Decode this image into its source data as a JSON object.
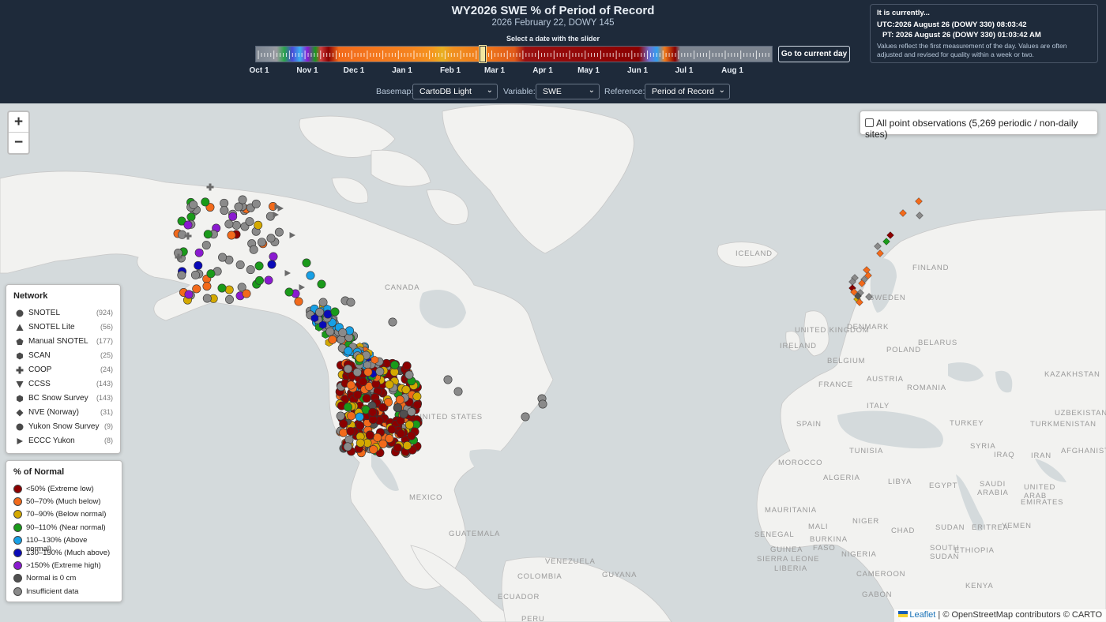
{
  "header": {
    "title": "WY2026 SWE % of Period of Record",
    "subtitle": "2026 February 22, DOWY 145",
    "slider_label": "Select a date with the slider",
    "goto_button": "Go to current day",
    "months": [
      "Oct 1",
      "Nov 1",
      "Dec 1",
      "Jan 1",
      "Feb 1",
      "Mar 1",
      "Apr 1",
      "May 1",
      "Jun 1",
      "Jul 1",
      "Aug 1"
    ],
    "slider_value_dowy": 145
  },
  "controls": {
    "basemap_label": "Basemap:",
    "basemap_value": "CartoDB Light",
    "variable_label": "Variable:",
    "variable_value": "SWE",
    "reference_label": "Reference:",
    "reference_value": "Period of Record"
  },
  "current": {
    "title": "It is currently...",
    "utc": "UTC:2026 August 26 (DOWY 330) 08:03:42",
    "pt": "PT: 2026 August 26 (DOWY 330) 01:03:42 AM",
    "note": "Values reflect the first measurement of the day. Values are often adjusted and revised for quality within a week or two."
  },
  "map": {
    "zoom_in": "+",
    "zoom_out": "−",
    "all_obs_label": "All point observations (5,269 periodic / non-daily sites)",
    "country_labels": [
      "CANADA",
      "UNITED STATES",
      "MEXICO",
      "GUATEMALA",
      "VENEZUELA",
      "COLOMBIA",
      "GUYANA",
      "ECUADOR",
      "PERU",
      "ICELAND",
      "FINLAND",
      "SWEDEN",
      "DENMARK",
      "UNITED KINGDOM",
      "IRELAND",
      "POLAND",
      "BELARUS",
      "BELGIUM",
      "FRANCE",
      "AUSTRIA",
      "ROMANIA",
      "KAZAKHSTAN",
      "ITALY",
      "UZBEKISTAN",
      "SPAIN",
      "TURKEY",
      "TURKMENISTAN",
      "TUNISIA",
      "SYRIA",
      "IRAQ",
      "IRAN",
      "AFGHANISTAN",
      "MOROCCO",
      "ALGERIA",
      "LIBYA",
      "EGYPT",
      "SAUDI ARABIA",
      "UNITED ARAB EMIRATES",
      "MAURITANIA",
      "MALI",
      "NIGER",
      "CHAD",
      "SUDAN",
      "ERITREA",
      "YEMEN",
      "SENEGAL",
      "BURKINA FASO",
      "GUINEA",
      "NIGERIA",
      "ETHIOPIA",
      "SOUTH SUDAN",
      "SIERRA LEONE",
      "LIBERIA",
      "CAMEROON",
      "GABON",
      "KENYA"
    ],
    "attribution_link": "Leaflet",
    "attribution_text": "| © OpenStreetMap contributors © CARTO"
  },
  "network_legend": {
    "title": "Network",
    "items": [
      {
        "name": "SNOTEL",
        "count": "(924)",
        "symbol": "circle"
      },
      {
        "name": "SNOTEL Lite",
        "count": "(56)",
        "symbol": "triangle"
      },
      {
        "name": "Manual SNOTEL",
        "count": "(177)",
        "symbol": "pentagon"
      },
      {
        "name": "SCAN",
        "count": "(25)",
        "symbol": "hexagon"
      },
      {
        "name": "COOP",
        "count": "(24)",
        "symbol": "cross"
      },
      {
        "name": "CCSS",
        "count": "(143)",
        "symbol": "triangle-down"
      },
      {
        "name": "BC Snow Survey",
        "count": "(143)",
        "symbol": "hexagon"
      },
      {
        "name": "NVE (Norway)",
        "count": "(31)",
        "symbol": "diamond"
      },
      {
        "name": "Yukon Snow Survey",
        "count": "(9)",
        "symbol": "circle"
      },
      {
        "name": "ECCC Yukon",
        "count": "(8)",
        "symbol": "triangle-right"
      }
    ]
  },
  "pct_legend": {
    "title": "% of Normal",
    "items": [
      {
        "name": "<50% (Extreme low)",
        "color": "#8b0000"
      },
      {
        "name": "50–70% (Much below)",
        "color": "#f26a1b"
      },
      {
        "name": "70–90% (Below normal)",
        "color": "#d4a900"
      },
      {
        "name": "90–110% (Near normal)",
        "color": "#1a9a1a"
      },
      {
        "name": "110–130% (Above normal)",
        "color": "#17a0e6"
      },
      {
        "name": "130–150% (Much above)",
        "color": "#0a0ab8"
      },
      {
        "name": ">150% (Extreme high)",
        "color": "#8a1ad0"
      },
      {
        "name": "Normal is 0 cm",
        "color": "#505050"
      },
      {
        "name": "Insufficient data",
        "color": "#8a8a8a"
      }
    ]
  }
}
